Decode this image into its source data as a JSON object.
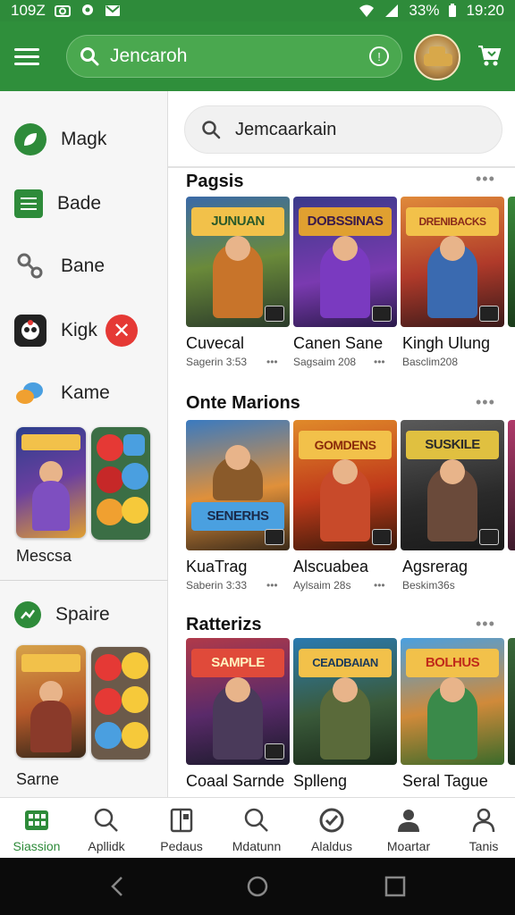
{
  "status": {
    "time_left": "109Z",
    "battery": "33%",
    "time_right": "19:20"
  },
  "topbar": {
    "search_text": "Jencaroh",
    "info_icon": "info-icon"
  },
  "drawer": {
    "items": [
      {
        "label": "Magk",
        "icon": "leaf-icon",
        "color": "#2e8b3a"
      },
      {
        "label": "Bade",
        "icon": "list-icon",
        "color": "#2e8b3a"
      },
      {
        "label": "Bane",
        "icon": "share-icon",
        "color": "#666666"
      },
      {
        "label": "Kigk",
        "icon": "app-icon",
        "color": "#333333"
      },
      {
        "label": "Kame",
        "icon": "gamepad-icon",
        "color": "#f0a030"
      }
    ],
    "section1_caption": "Mescsa",
    "section2_label": "Spaire",
    "section2_caption": "Sarne"
  },
  "content": {
    "search_text": "Jemcaarkain",
    "sections": [
      {
        "title": "Pagsis",
        "cards": [
          {
            "title": "Cuvecal",
            "sub": "Sagerin 3:53",
            "banner": "JUNUAN"
          },
          {
            "title": "Canen Sane",
            "sub": "Sagsaim 208",
            "banner": "DOBSSINAS"
          },
          {
            "title": "Kingh Ulung",
            "sub": "Basclim208",
            "banner": "DRENIBACKS"
          }
        ]
      },
      {
        "title": "Onte Marions",
        "cards": [
          {
            "title": "KuaTrag",
            "sub": "Saberin 3:33",
            "banner": "SENERHS"
          },
          {
            "title": "Alscuabea",
            "sub": "Aylsaim 28s",
            "banner": "GOMDENS"
          },
          {
            "title": "Agsrerag",
            "sub": "Beskim36s",
            "banner": "SUSKILE"
          }
        ]
      },
      {
        "title": "Ratterizs",
        "cards": [
          {
            "title": "Coaal Sarnde",
            "sub": "",
            "banner": "SAMPLE"
          },
          {
            "title": "Splleng",
            "sub": "",
            "banner": "CEADBAIAN"
          },
          {
            "title": "Seral Tague",
            "sub": "",
            "banner": "BOLHUS"
          }
        ]
      }
    ]
  },
  "bottom_nav": [
    {
      "label": "Siassion",
      "icon": "grid-icon",
      "active": true
    },
    {
      "label": "Apllidk",
      "icon": "search-icon",
      "active": false
    },
    {
      "label": "Pedaus",
      "icon": "book-icon",
      "active": false
    },
    {
      "label": "Mdatunn",
      "icon": "search-icon",
      "active": false
    },
    {
      "label": "Alaldus",
      "icon": "check-circle-icon",
      "active": false
    },
    {
      "label": "Moartar",
      "icon": "person-icon",
      "active": false
    },
    {
      "label": "Tanis",
      "icon": "person-outline-icon",
      "active": false
    }
  ],
  "colors": {
    "primary": "#2f8f3b",
    "accent_red": "#e53935"
  }
}
